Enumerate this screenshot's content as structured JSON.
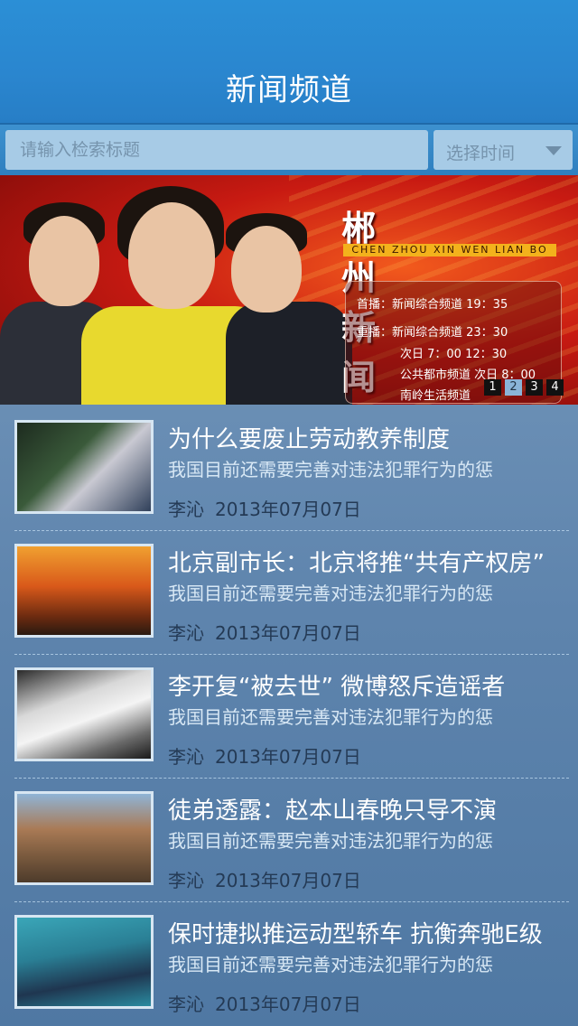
{
  "header": {
    "title": "新闻频道"
  },
  "search": {
    "placeholder": "请输入检索标题",
    "time_select_label": "选择时间"
  },
  "banner": {
    "logo": "郴州新闻联播",
    "logo_pinyin": "CHEN ZHOU XIN WEN LIAN BO",
    "schedule": [
      "首播：新闻综合频道  19：35",
      "重播：新闻综合频道  23：30",
      "次日  7：00   12：30",
      "公共都市频道   次日  8：00",
      "南岭生活频道"
    ],
    "pager": [
      "1",
      "2",
      "3",
      "4"
    ],
    "pager_active": 1
  },
  "news": [
    {
      "title": "为什么要废止劳动教养制度",
      "desc": "我国目前还需要完善对违法犯罪行为的惩",
      "author": "李沁",
      "date": "2013年07月07日"
    },
    {
      "title": "北京副市长：北京将推“共有产权房”",
      "desc": "我国目前还需要完善对违法犯罪行为的惩",
      "author": "李沁",
      "date": "2013年07月07日"
    },
    {
      "title": "李开复“被去世” 微博怒斥造谣者",
      "desc": "我国目前还需要完善对违法犯罪行为的惩",
      "author": "李沁",
      "date": "2013年07月07日"
    },
    {
      "title": "徒弟透露：赵本山春晚只导不演",
      "desc": "我国目前还需要完善对违法犯罪行为的惩",
      "author": "李沁",
      "date": "2013年07月07日"
    },
    {
      "title": "保时捷拟推运动型轿车 抗衡奔驰E级",
      "desc": "我国目前还需要完善对违法犯罪行为的惩",
      "author": "李沁",
      "date": "2013年07月07日"
    }
  ],
  "colors": {
    "header_blue": "#2a86cf",
    "banner_red": "#c81a12",
    "list_bg": "#6f93b8",
    "title_text": "#ffffff",
    "meta_text": "#243a55"
  }
}
